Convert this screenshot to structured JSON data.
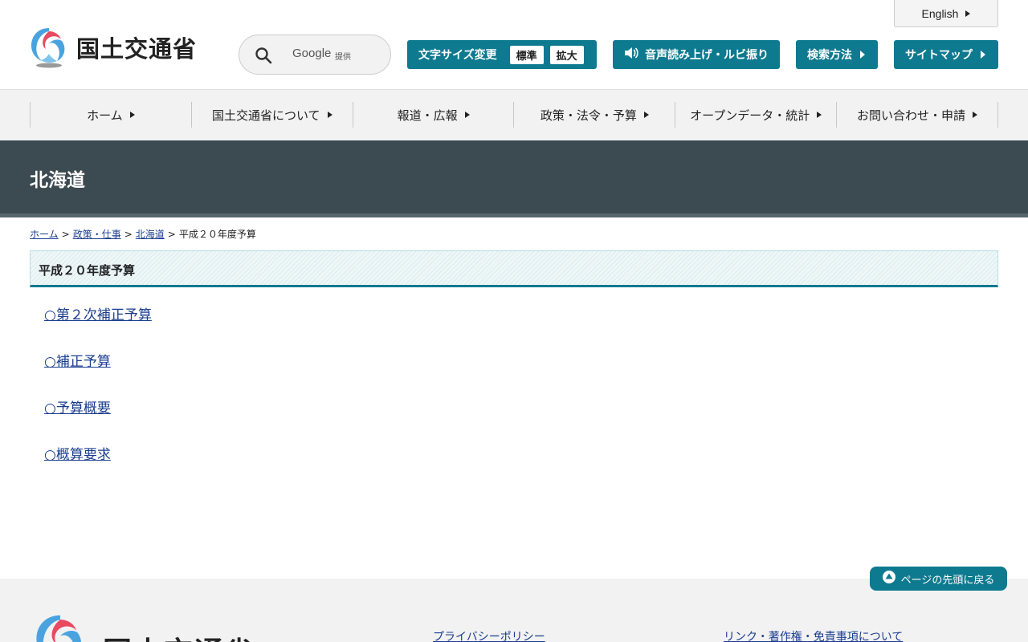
{
  "header": {
    "logo_text": "国土交通省",
    "search": {
      "brand": "Google",
      "provided": "提供"
    },
    "fontsize": {
      "label": "文字サイズ変更",
      "standard": "標準",
      "large": "拡大"
    },
    "voice_label": "音声読み上げ・ルビ振り",
    "search_method_label": "検索方法",
    "sitemap_label": "サイトマップ",
    "english_label": "English"
  },
  "nav": {
    "items": [
      {
        "label": "ホーム"
      },
      {
        "label": "国土交通省について"
      },
      {
        "label": "報道・広報"
      },
      {
        "label": "政策・法令・予算"
      },
      {
        "label": "オープンデータ・統計"
      },
      {
        "label": "お問い合わせ・申請"
      }
    ]
  },
  "page": {
    "band_title": "北海道"
  },
  "breadcrumb": {
    "items": [
      "ホーム",
      "政策・仕事",
      "北海道"
    ],
    "current": "平成２０年度予算",
    "separator": ">"
  },
  "content": {
    "title": "平成２０年度予算",
    "links": [
      "○第２次補正予算",
      "○補正予算",
      "○予算概要",
      "○概算要求"
    ]
  },
  "pagetop_label": "ページの先頭に戻る",
  "footer": {
    "logo_text": "国土交通省",
    "privacy_label": "プライバシーポリシー",
    "links_label": "リンク・著作権・免責事項について"
  },
  "colors": {
    "accent": "#0e7a8f",
    "band": "#3c4a51",
    "link": "#1a3d8f",
    "nav_bg": "#f2f2f2"
  }
}
